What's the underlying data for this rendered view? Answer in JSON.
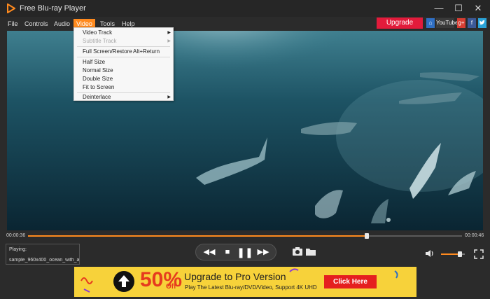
{
  "window": {
    "title": "Free Blu-ray Player",
    "logo_icon": "play-logo-icon",
    "buttons": [
      "minimize-icon",
      "maximize-icon",
      "close-icon"
    ]
  },
  "menu": {
    "items": [
      "File",
      "Controls",
      "Audio",
      "Video",
      "Tools",
      "Help"
    ],
    "active": "Video"
  },
  "toolbar": {
    "upgrade_label": "Upgrade",
    "social": {
      "youtube_label": "YouTube",
      "gplus_label": "g+",
      "facebook_label": "f"
    }
  },
  "video_menu": {
    "video_track": "Video Track",
    "subtitle_track": "Subtitle Track",
    "fullscreen": "Full Screen/Restore",
    "fullscreen_shortcut": "Alt+Return",
    "half_size": "Half Size",
    "normal_size": "Normal Size",
    "double_size": "Double Size",
    "fit_to_screen": "Fit to Screen",
    "deinterlace": "Deinterlace"
  },
  "timeline": {
    "current": "00:00:36",
    "total": "00:00:46",
    "progress": 0.78
  },
  "now_playing": {
    "label": "Playing:",
    "file": "sample_960x400_ocean_with_a..."
  },
  "controls": {
    "icons": [
      "rewind-icon",
      "stop-icon",
      "pause-icon",
      "fast-forward-icon",
      "snapshot-icon",
      "folder-icon",
      "volume-icon",
      "fullscreen-icon"
    ],
    "volume": 0.8
  },
  "ad": {
    "percent": "50%",
    "off": "Off",
    "title": "Upgrade to Pro Version",
    "subtitle": "Play The Latest Blu-ray/DVD/Video, Support 4K UHD",
    "cta": "Click Here"
  },
  "colors": {
    "accent": "#ff8a1e",
    "upgrade": "#e21b3b",
    "ad_bg": "#f7d23a",
    "ad_cta": "#e51f1f"
  }
}
